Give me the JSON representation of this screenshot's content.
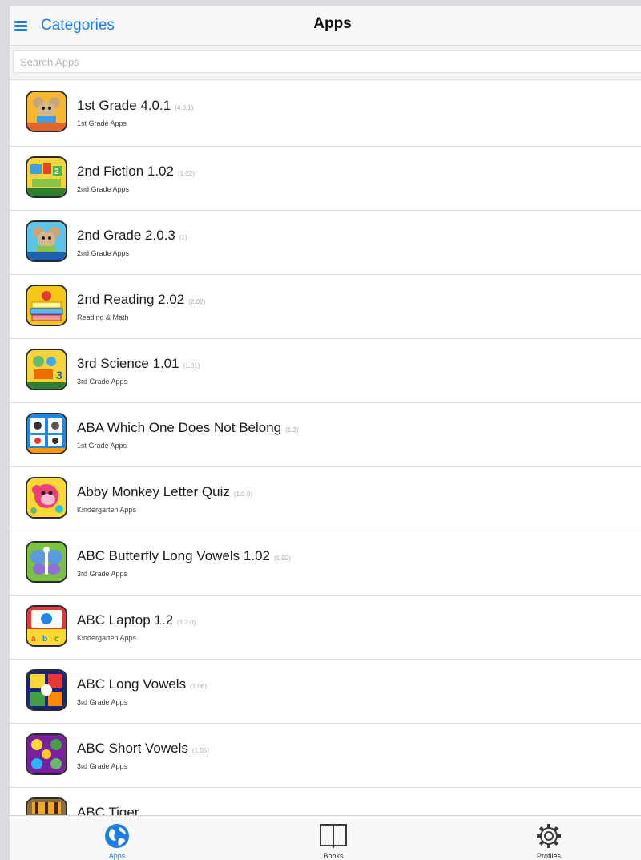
{
  "header": {
    "menu_label": "Categories",
    "title": "Apps"
  },
  "search": {
    "placeholder": "Search Apps"
  },
  "apps": [
    {
      "name": "1st Grade 4.0.1",
      "version": "(4.0.1)",
      "category": "1st Grade Apps",
      "icon": "mouse-teacher-icon"
    },
    {
      "name": "2nd Fiction 1.02",
      "version": "(1.02)",
      "category": "2nd Grade Apps",
      "icon": "fiction-books-icon"
    },
    {
      "name": "2nd Grade 2.0.3",
      "version": "(1)",
      "category": "2nd Grade Apps",
      "icon": "mouse-teacher-icon"
    },
    {
      "name": "2nd Reading 2.02",
      "version": "(2.02)",
      "category": "Reading & Math",
      "icon": "reading-books-icon"
    },
    {
      "name": "3rd Science 1.01",
      "version": "(1.01)",
      "category": "3rd Grade Apps",
      "icon": "science-icon"
    },
    {
      "name": "ABA Which One Does Not Belong",
      "version": "(1.2)",
      "category": "1st Grade Apps",
      "icon": "aba-cards-icon"
    },
    {
      "name": "Abby Monkey Letter Quiz",
      "version": "(1.0.0)",
      "category": "Kindergarten Apps",
      "icon": "monkey-icon"
    },
    {
      "name": "ABC Butterfly Long Vowels 1.02",
      "version": "(1.02)",
      "category": "3rd Grade Apps",
      "icon": "butterfly-icon"
    },
    {
      "name": "ABC Laptop 1.2",
      "version": "(1.2.0)",
      "category": "Kindergarten Apps",
      "icon": "laptop-icon"
    },
    {
      "name": "ABC Long Vowels",
      "version": "(1.06)",
      "category": "3rd Grade Apps",
      "icon": "long-vowels-icon"
    },
    {
      "name": "ABC Short Vowels",
      "version": "(1.05)",
      "category": "3rd Grade Apps",
      "icon": "short-vowels-icon"
    },
    {
      "name": "ABC Tiger",
      "version": "",
      "category": "",
      "icon": "tiger-icon"
    }
  ],
  "tabs": [
    {
      "label": "Apps",
      "icon": "globe-icon",
      "active": true
    },
    {
      "label": "Books",
      "icon": "book-icon",
      "active": false
    },
    {
      "label": "Profiles",
      "icon": "gear-icon",
      "active": false
    }
  ],
  "colors": {
    "accent": "#1b7ee0",
    "separator": "#dcdcdc",
    "bar_background": "#f8f8f8"
  }
}
